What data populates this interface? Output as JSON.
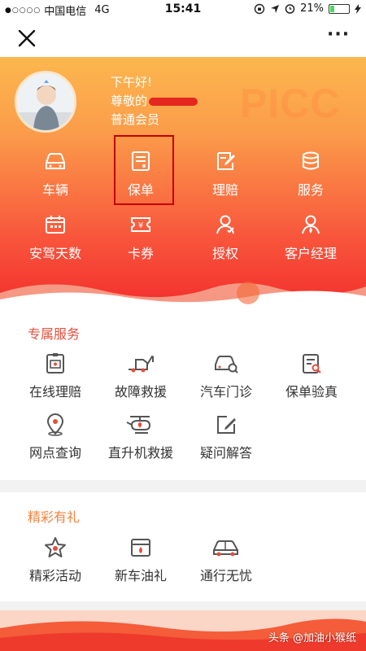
{
  "status_bar": {
    "signal": "●○○○○",
    "carrier": "中国电信",
    "network": "4G",
    "time": "15:41",
    "battery_pct": "21%",
    "battery_level": 0.21
  },
  "nav": {
    "close_icon": "close-icon",
    "more_icon": "more-icon",
    "more_label": "···"
  },
  "profile": {
    "greeting": "下午好!",
    "salutation": "尊敬的",
    "member_level": "普通会员",
    "watermark_logo": "PICC"
  },
  "quick_menu": [
    {
      "label": "车辆",
      "icon": "car-icon"
    },
    {
      "label": "保单",
      "icon": "policy-icon"
    },
    {
      "label": "理赔",
      "icon": "claim-icon"
    },
    {
      "label": "服务",
      "icon": "service-icon"
    },
    {
      "label": "安驾天数",
      "icon": "calendar-icon"
    },
    {
      "label": "卡券",
      "icon": "coupon-icon"
    },
    {
      "label": "授权",
      "icon": "authorize-icon"
    },
    {
      "label": "客户经理",
      "icon": "manager-icon"
    }
  ],
  "exclusive": {
    "title": "专属服务",
    "items": [
      {
        "label": "在线理赔",
        "icon": "online-claim-icon"
      },
      {
        "label": "故障救援",
        "icon": "tow-truck-icon"
      },
      {
        "label": "汽车门诊",
        "icon": "car-clinic-icon"
      },
      {
        "label": "保单验真",
        "icon": "verify-policy-icon"
      },
      {
        "label": "网点查询",
        "icon": "location-icon"
      },
      {
        "label": "直升机救援",
        "icon": "helicopter-icon"
      },
      {
        "label": "疑问解答",
        "icon": "faq-icon"
      }
    ]
  },
  "gifts": {
    "title": "精彩有礼",
    "items": [
      {
        "label": "精彩活动",
        "icon": "star-icon"
      },
      {
        "label": "新车油礼",
        "icon": "fuel-card-icon"
      },
      {
        "label": "通行无忧",
        "icon": "car-pass-icon"
      }
    ]
  },
  "footer": {
    "watermark": "头条 @加油小猴纸"
  },
  "colors": {
    "accent": "#e64e3c",
    "highlight": "#c40000",
    "icon_gray": "#555555",
    "icon_red": "#e64e3c"
  }
}
